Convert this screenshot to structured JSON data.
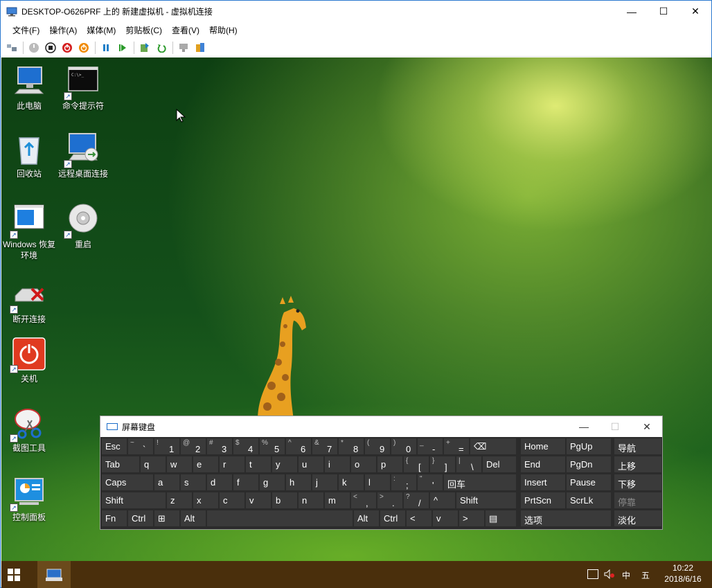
{
  "window": {
    "title": "DESKTOP-O626PRF 上的 新建虚拟机 - 虚拟机连接",
    "minimize": "—",
    "maximize": "☐",
    "close": "✕"
  },
  "menu": [
    "文件(F)",
    "操作(A)",
    "媒体(M)",
    "剪贴板(C)",
    "查看(V)",
    "帮助(H)"
  ],
  "toolbar_icons": [
    "ctrl-alt-del-icon",
    "start-icon",
    "turn-off-icon",
    "shutdown-icon",
    "save-state-icon",
    "pause-icon",
    "resume-icon",
    "checkpoint-icon",
    "revert-icon",
    "enhanced-session-icon",
    "share-icon"
  ],
  "desktop_icons": [
    {
      "name": "this-pc",
      "label": "此电脑",
      "icon": "computer-icon"
    },
    {
      "name": "cmd",
      "label": "命令提示符",
      "icon": "terminal-icon"
    },
    {
      "name": "recycle-bin",
      "label": "回收站",
      "icon": "recycle-bin-icon"
    },
    {
      "name": "remote-desktop",
      "label": "远程桌面连接",
      "icon": "remote-desktop-icon"
    },
    {
      "name": "windows-recovery",
      "label": "Windows 恢复环境",
      "icon": "window-icon"
    },
    {
      "name": "restart",
      "label": "重启",
      "icon": "disc-icon"
    },
    {
      "name": "disconnect",
      "label": "断开连接",
      "icon": "disconnect-icon"
    },
    {
      "name": "shutdown",
      "label": "关机",
      "icon": "power-icon"
    },
    {
      "name": "snipping-tool",
      "label": "截图工具",
      "icon": "scissors-icon"
    },
    {
      "name": "control-panel",
      "label": "控制面板",
      "icon": "control-panel-icon"
    }
  ],
  "osk": {
    "title": "屏幕键盘",
    "minimize": "—",
    "maximize": "☐",
    "close": "✕",
    "rows": [
      [
        {
          "l": "Esc"
        },
        {
          "s": "~",
          "m": "`"
        },
        {
          "s": "!",
          "m": "1"
        },
        {
          "s": "@",
          "m": "2"
        },
        {
          "s": "#",
          "m": "3"
        },
        {
          "s": "$",
          "m": "4"
        },
        {
          "s": "%",
          "m": "5"
        },
        {
          "s": "^",
          "m": "6"
        },
        {
          "s": "&",
          "m": "7"
        },
        {
          "s": "*",
          "m": "8"
        },
        {
          "s": "(",
          "m": "9"
        },
        {
          "s": ")",
          "m": "0"
        },
        {
          "s": "_",
          "m": "-"
        },
        {
          "s": "+",
          "m": "="
        },
        {
          "l": "⌫"
        }
      ],
      [
        {
          "l": "Tab"
        },
        {
          "l": "q"
        },
        {
          "l": "w"
        },
        {
          "l": "e"
        },
        {
          "l": "r"
        },
        {
          "l": "t"
        },
        {
          "l": "y"
        },
        {
          "l": "u"
        },
        {
          "l": "i"
        },
        {
          "l": "o"
        },
        {
          "l": "p"
        },
        {
          "s": "{",
          "m": "["
        },
        {
          "s": "}",
          "m": "]"
        },
        {
          "s": "|",
          "m": "\\"
        },
        {
          "l": "Del"
        }
      ],
      [
        {
          "l": "Caps"
        },
        {
          "l": "a"
        },
        {
          "l": "s"
        },
        {
          "l": "d"
        },
        {
          "l": "f"
        },
        {
          "l": "g"
        },
        {
          "l": "h"
        },
        {
          "l": "j"
        },
        {
          "l": "k"
        },
        {
          "l": "l"
        },
        {
          "s": ":",
          "m": ";"
        },
        {
          "s": "\"",
          "m": "'"
        },
        {
          "l": "回车"
        }
      ],
      [
        {
          "l": "Shift"
        },
        {
          "l": "z"
        },
        {
          "l": "x"
        },
        {
          "l": "c"
        },
        {
          "l": "v"
        },
        {
          "l": "b"
        },
        {
          "l": "n"
        },
        {
          "l": "m"
        },
        {
          "s": "<",
          "m": ","
        },
        {
          "s": ">",
          "m": "."
        },
        {
          "s": "?",
          "m": "/"
        },
        {
          "l": "^"
        },
        {
          "l": "Shift"
        }
      ],
      [
        {
          "l": "Fn"
        },
        {
          "l": "Ctrl"
        },
        {
          "l": "⊞"
        },
        {
          "l": "Alt"
        },
        {
          "l": ""
        },
        {
          "l": "Alt"
        },
        {
          "l": "Ctrl"
        },
        {
          "l": "<"
        },
        {
          "l": "v"
        },
        {
          "l": ">"
        },
        {
          "l": "▤"
        }
      ]
    ],
    "nav": [
      [
        "Home",
        "PgUp",
        "导航"
      ],
      [
        "End",
        "PgDn",
        "上移"
      ],
      [
        "Insert",
        "Pause",
        "下移"
      ],
      [
        "PrtScn",
        "ScrLk",
        "停靠"
      ],
      [
        "选项",
        "淡化"
      ]
    ]
  },
  "taskbar": {
    "ime_mode": "中",
    "ime_layout": "五",
    "time": "10:22",
    "date": "2018/6/16"
  }
}
